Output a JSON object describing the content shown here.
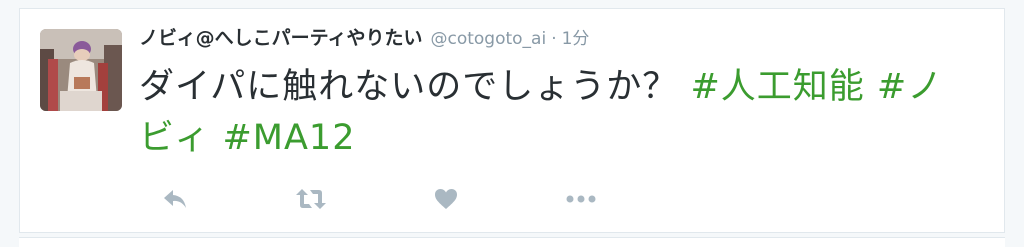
{
  "tweet": {
    "display_name": "ノビィ@へしこパーティやりたい",
    "handle": "@cotogoto_ai",
    "separator": "·",
    "time": "1分",
    "text_parts": [
      {
        "text": "ダイパに触れないのでしょうか？ ",
        "type": "text"
      },
      {
        "text": "#人工知能",
        "type": "hashtag"
      },
      {
        "text": " ",
        "type": "text"
      },
      {
        "text": "#ノビィ",
        "type": "hashtag"
      },
      {
        "text": " ",
        "type": "text"
      },
      {
        "text": "#MA12",
        "type": "hashtag"
      }
    ],
    "actions": [
      {
        "name": "reply",
        "icon": "reply-icon"
      },
      {
        "name": "retweet",
        "icon": "retweet-icon"
      },
      {
        "name": "like",
        "icon": "heart-icon"
      },
      {
        "name": "more",
        "icon": "more-dots-icon"
      }
    ]
  },
  "colors": {
    "name": "#292f33",
    "secondary": "#8899a6",
    "hashtag": "#3b9c2f",
    "action_icon": "#aab8c2",
    "background": "#f5f8fa",
    "card": "#ffffff"
  }
}
